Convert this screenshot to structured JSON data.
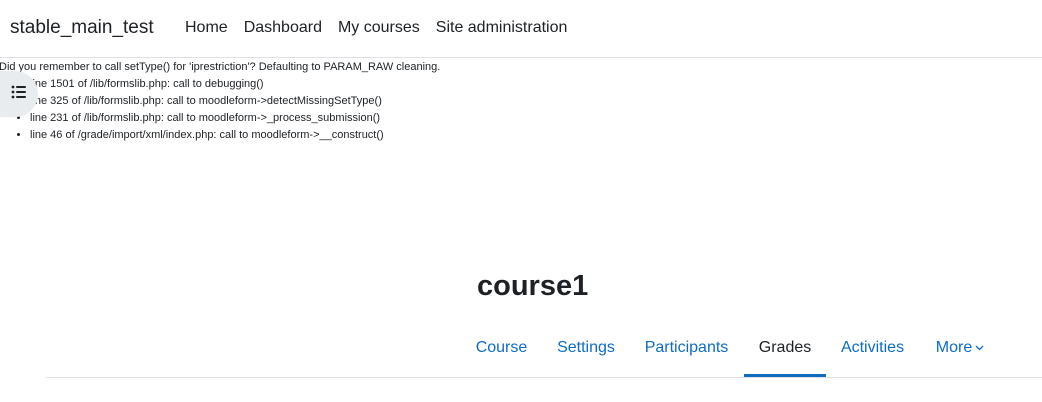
{
  "navbar": {
    "site_name": "stable_main_test",
    "items": [
      "Home",
      "Dashboard",
      "My courses",
      "Site administration"
    ]
  },
  "debug": {
    "message": "Did you remember to call setType() for 'iprestriction'? Defaulting to PARAM_RAW cleaning.",
    "trace": [
      "line 1501 of /lib/formslib.php: call to debugging()",
      "line 325 of /lib/formslib.php: call to moodleform->detectMissingSetType()",
      "line 231 of /lib/formslib.php: call to moodleform->_process_submission()",
      "line 46 of /grade/import/xml/index.php: call to moodleform->__construct()"
    ]
  },
  "drawer_toggle": {
    "icon": "list-icon"
  },
  "course": {
    "title": "course1"
  },
  "secondary_nav": {
    "tabs": [
      "Course",
      "Settings",
      "Participants",
      "Grades",
      "Activities",
      "More"
    ],
    "active": "Grades",
    "more_icon": "chevron-down-icon"
  },
  "colors": {
    "link": "#0f6cbf",
    "text": "#1d2125",
    "border": "#dee2e6",
    "toggle_bg": "#e9ecef"
  }
}
